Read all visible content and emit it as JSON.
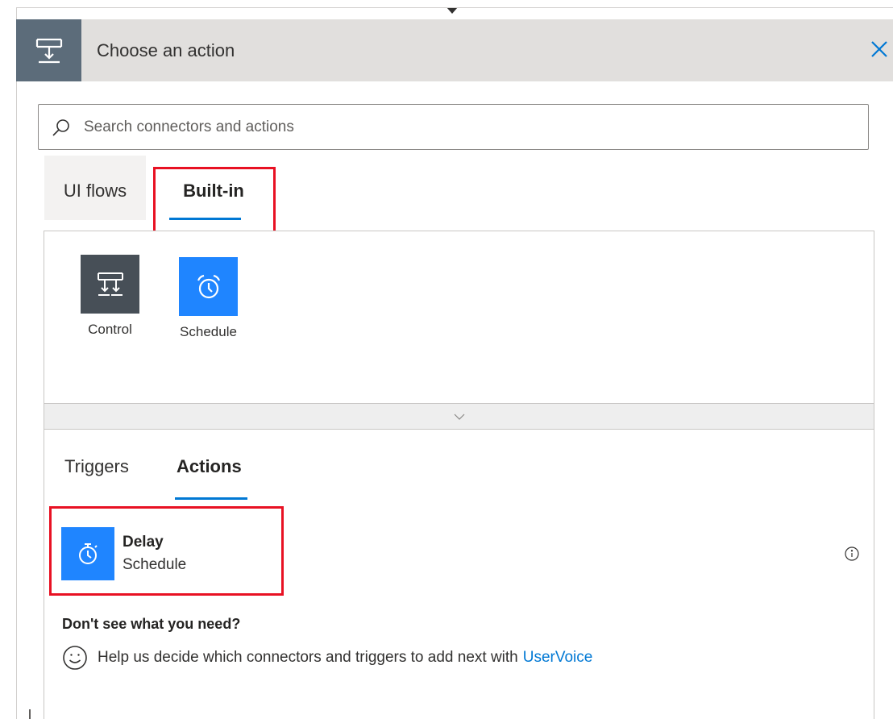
{
  "header": {
    "title": "Choose an action",
    "icon": "control-icon",
    "close_icon": "close-icon"
  },
  "search": {
    "placeholder": "Search connectors and actions",
    "value": ""
  },
  "tabs": [
    {
      "label": "UI flows",
      "selected": false
    },
    {
      "label": "Built-in",
      "selected": true
    }
  ],
  "connectors": [
    {
      "label": "Control",
      "icon": "control-icon",
      "color": "#474f57"
    },
    {
      "label": "Schedule",
      "icon": "alarm-clock-icon",
      "color": "#1f85ff"
    }
  ],
  "subtabs": [
    {
      "label": "Triggers",
      "selected": false
    },
    {
      "label": "Actions",
      "selected": true
    }
  ],
  "actions": [
    {
      "name": "Delay",
      "connector": "Schedule",
      "icon": "stopwatch-icon",
      "info_icon": "info-icon"
    }
  ],
  "footer": {
    "heading": "Don't see what you need?",
    "help_text": "Help us decide which connectors and triggers to add next with",
    "link_text": "UserVoice"
  },
  "colors": {
    "accent": "#0078d4",
    "highlight": "#e81123",
    "header_bg": "#e1dfdd",
    "header_icon_bg": "#5c6c7a"
  }
}
